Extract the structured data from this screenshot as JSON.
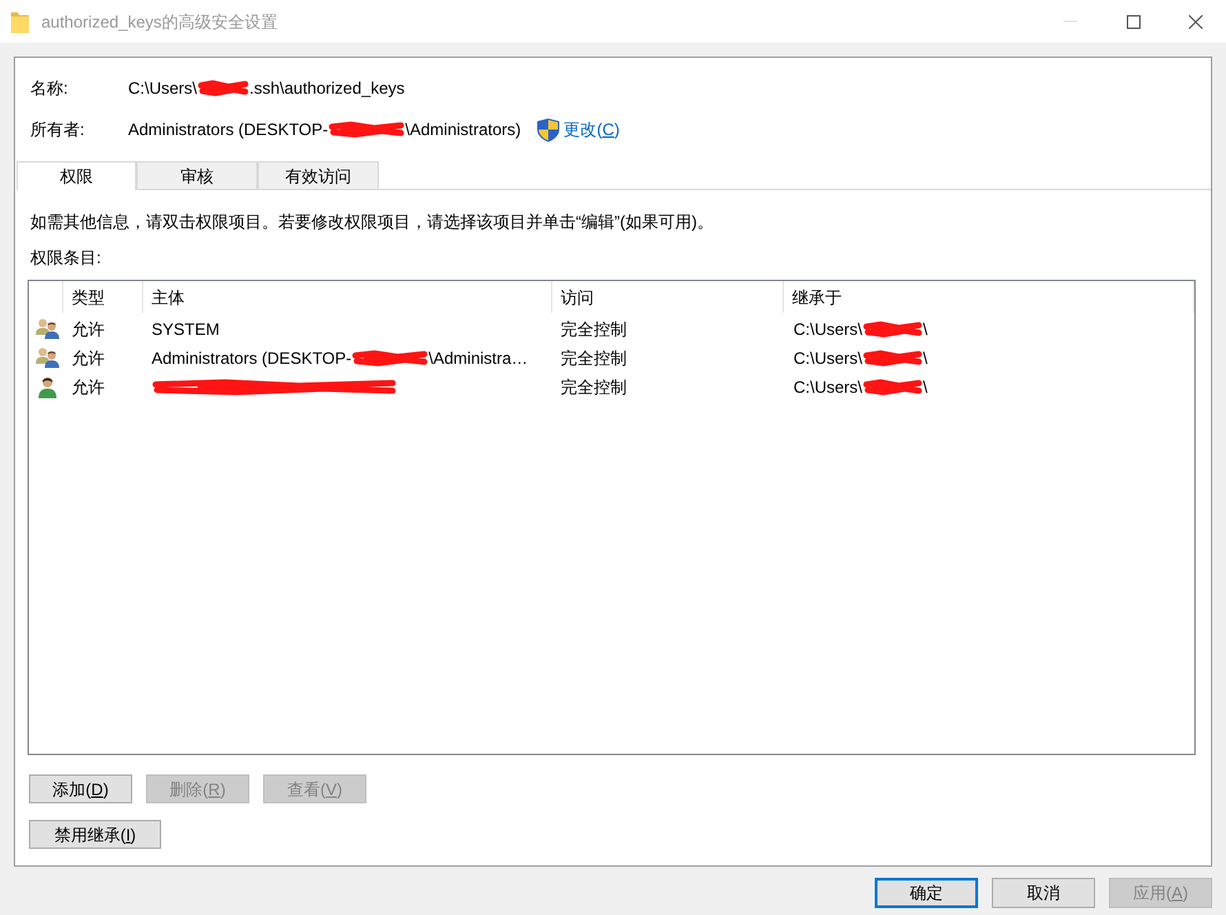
{
  "window": {
    "title": "authorized_keys的高级安全设置",
    "minimize_disabled": true
  },
  "fields": [
    {
      "label": "名称:",
      "value": {
        "before": "C:\\Users\\",
        "redacted": true,
        "after": ".ssh\\authorized_keys"
      }
    },
    {
      "label": "所有者:",
      "value": {
        "before": "Administrators (DESKTOP-",
        "redacted": true,
        "after": "\\Administrators)"
      },
      "link": {
        "label_parts": [
          "更改(",
          "C",
          ")"
        ]
      }
    }
  ],
  "tabs": [
    {
      "label": "权限",
      "selected": true
    },
    {
      "label": "审核",
      "selected": false
    },
    {
      "label": "有效访问",
      "selected": false
    }
  ],
  "permissions": {
    "info": "如需其他信息，请双击权限项目。若要修改权限项目，请选择该项目并单击“编辑”(如果可用)。",
    "list_label": "权限条目:",
    "table": {
      "columns": [
        "类型",
        "主体",
        "访问",
        "继承于"
      ],
      "rows": [
        {
          "kind": "group",
          "selected": false,
          "type": "允许",
          "principal": {
            "before": "SYSTEM",
            "redacted": false
          },
          "access": "完全控制",
          "inherited_from": {
            "before": "C:\\Users\\",
            "redacted": true,
            "after": "\\"
          }
        },
        {
          "kind": "group",
          "selected": false,
          "type": "允许",
          "principal": {
            "before": "Administrators (DESKTOP-",
            "redacted": true,
            "after": "\\Administra…"
          },
          "access": "完全控制",
          "inherited_from": {
            "before": "C:\\Users\\",
            "redacted": true,
            "after": "\\"
          }
        },
        {
          "kind": "user",
          "selected": false,
          "type": "允许",
          "principal": {
            "redacted": true
          },
          "access": "完全控制",
          "inherited_from": {
            "before": "C:\\Users\\",
            "redacted": true,
            "after": "\\"
          }
        }
      ]
    }
  },
  "entry_buttons": [
    {
      "label_parts": [
        "添加(",
        "D",
        ")"
      ],
      "disabled": false
    },
    {
      "label_parts": [
        "删除(",
        "R",
        ")"
      ],
      "disabled": true
    },
    {
      "label_parts": [
        "查看(",
        "V",
        ")"
      ],
      "disabled": true
    }
  ],
  "inheritance_button": {
    "label_parts": [
      "禁用继承(",
      "I",
      ")"
    ],
    "disabled": false
  },
  "dialog_buttons": [
    {
      "label_parts": [
        "确定"
      ],
      "default": true,
      "disabled": false
    },
    {
      "label_parts": [
        "取消"
      ],
      "default": false,
      "disabled": false
    },
    {
      "label_parts": [
        "应用(",
        "A",
        ")"
      ],
      "default": false,
      "disabled": true
    }
  ]
}
